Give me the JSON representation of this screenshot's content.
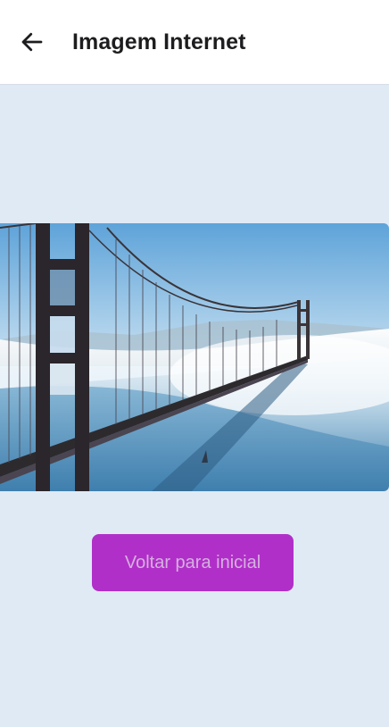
{
  "header": {
    "title": "Imagem Internet",
    "back_icon": "arrow-left-icon"
  },
  "image": {
    "alt": "Golden Gate Bridge in fog"
  },
  "button": {
    "label": "Voltar para inicial"
  },
  "colors": {
    "background": "#dfeaf5",
    "header": "#ffffff",
    "button": "#b12fc9",
    "button_text": "#d4b1df"
  }
}
